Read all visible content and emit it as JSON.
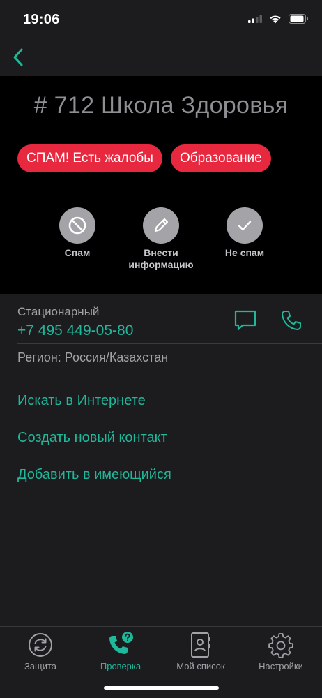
{
  "status_bar": {
    "time": "19:06"
  },
  "nav": {
    "back_icon": "chevron-left-icon"
  },
  "header": {
    "title": "# 712 Школа Здоровья",
    "tags": [
      "СПАМ! Есть жалобы",
      "Образование"
    ],
    "actions": [
      {
        "label": "Спам",
        "icon": "block-icon"
      },
      {
        "label": "Внести\nинформацию",
        "icon": "pencil-icon"
      },
      {
        "label": "Не спам",
        "icon": "checkmark-icon"
      }
    ]
  },
  "info": {
    "phone_type": "Стационарный",
    "phone_number": "+7 495 449-05-80",
    "region": "Регион: Россия/Казахстан"
  },
  "links": [
    "Искать в Интернете",
    "Создать новый контакт",
    "Добавить в имеющийся"
  ],
  "tabs": [
    {
      "label": "Защита",
      "icon": "sync-shield-icon",
      "active": false
    },
    {
      "label": "Проверка",
      "icon": "phone-question-icon",
      "active": true
    },
    {
      "label": "Мой список",
      "icon": "contacts-book-icon",
      "active": false
    },
    {
      "label": "Настройки",
      "icon": "gear-icon",
      "active": false
    }
  ],
  "colors": {
    "accent": "#1fb89b",
    "tag": "#e8283f",
    "background": "#1c1c1e",
    "header_bg": "#000000"
  }
}
